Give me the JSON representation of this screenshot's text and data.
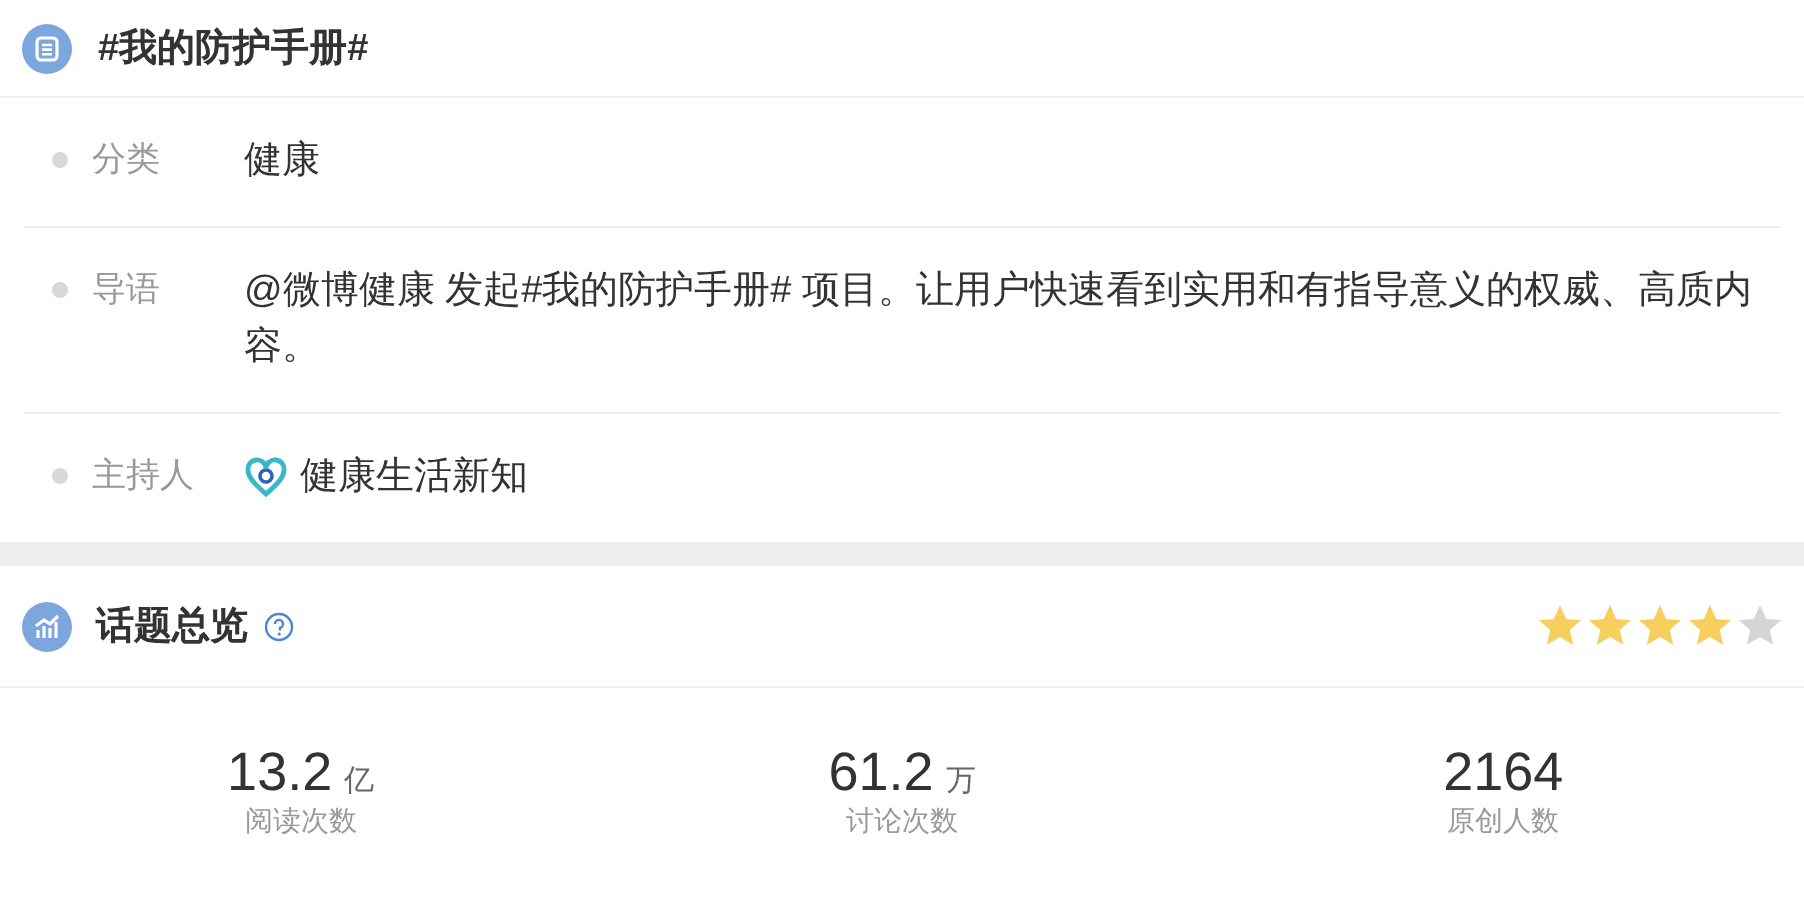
{
  "topic": {
    "title": "#我的防护手册#",
    "fields": [
      {
        "label": "分类",
        "kind": "text",
        "value": "健康"
      },
      {
        "label": "导语",
        "kind": "text",
        "value": "@微博健康 发起#我的防护手册# 项目。让用户快速看到实用和有指导意义的权威、高质内容。"
      },
      {
        "label": "主持人",
        "kind": "host",
        "value": "健康生活新知"
      }
    ]
  },
  "overview": {
    "title": "话题总览",
    "stars": 4,
    "stats": [
      {
        "value": "13.2",
        "unit": "亿",
        "label": "阅读次数"
      },
      {
        "value": "61.2",
        "unit": "万",
        "label": "讨论次数"
      },
      {
        "value": "2164",
        "label": "原创人数"
      }
    ]
  }
}
